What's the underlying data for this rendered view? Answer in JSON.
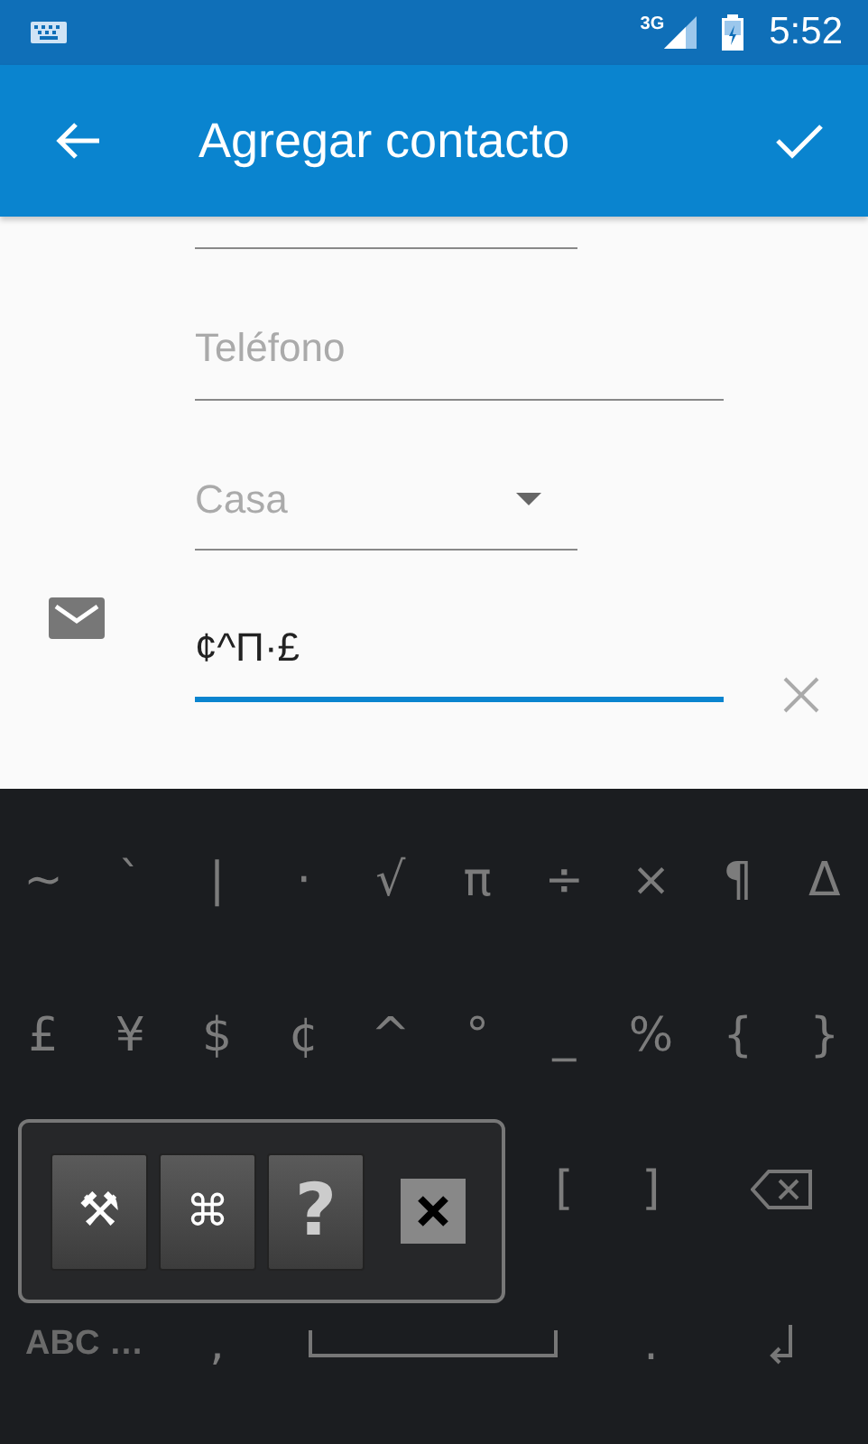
{
  "status_bar": {
    "network": "3G",
    "time": "5:52"
  },
  "app_bar": {
    "title": "Agregar contacto"
  },
  "form": {
    "phone": {
      "placeholder": "Teléfono"
    },
    "phone_type": {
      "value": "Casa"
    },
    "email": {
      "value": "¢^Π·£",
      "focused": true
    }
  },
  "keyboard": {
    "rows": [
      [
        "~",
        "`",
        "|",
        "·",
        "√",
        "π",
        "÷",
        "×",
        "¶",
        "Δ"
      ],
      [
        "£",
        "¥",
        "$",
        "¢",
        "^",
        "°",
        "_",
        "%",
        "{",
        "}"
      ]
    ],
    "row_3": [
      "[",
      "]"
    ],
    "bottom": {
      "mode_key": "ABC …",
      "comma": ",",
      "period": "."
    },
    "popup": {
      "buttons": [
        {
          "label": "⚒",
          "kind": "tools"
        },
        {
          "label": "⌘",
          "kind": "command"
        },
        {
          "label": "?",
          "kind": "help"
        }
      ]
    }
  }
}
